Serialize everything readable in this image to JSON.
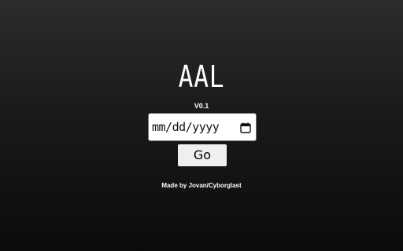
{
  "app": {
    "title": "AAL",
    "version": "V0.1"
  },
  "form": {
    "date_placeholder": "mm/dd/yyyy",
    "calendar_icon": "calendar-icon",
    "go_label": "Go"
  },
  "footer": {
    "credit": "Made by Jovan/Cyborglast"
  },
  "colors": {
    "background_top": "#2c2c2c",
    "background_bottom": "#0b0b0b",
    "text": "#ffffff",
    "button_bg": "#efefef"
  }
}
